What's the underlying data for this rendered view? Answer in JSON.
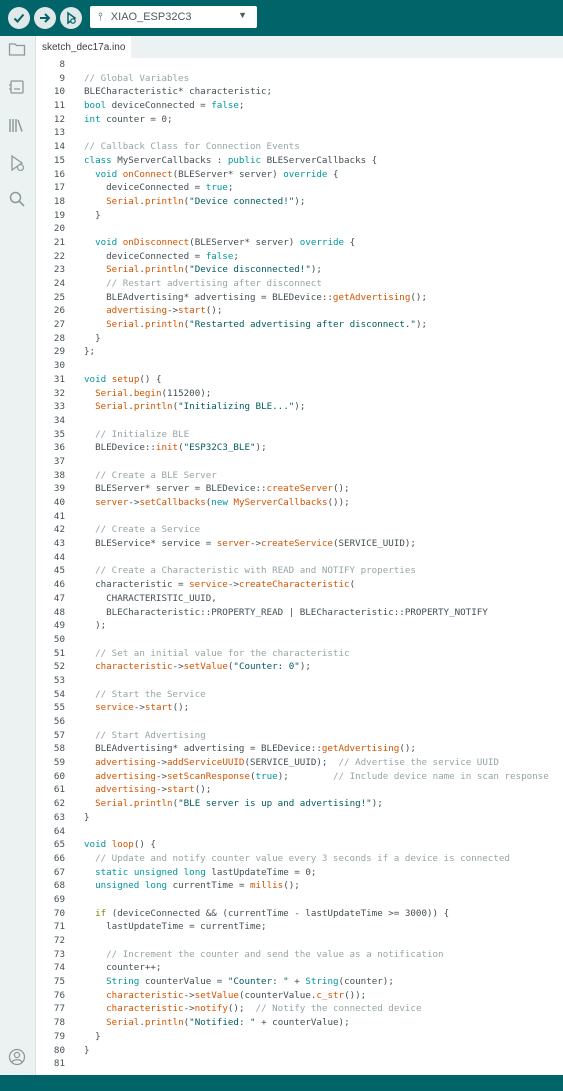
{
  "toolbar": {
    "verify_icon": "check-icon",
    "upload_icon": "arrow-right-icon",
    "debug_icon": "debug-icon",
    "board": "XIAO_ESP32C3",
    "board_icon": "usb-icon"
  },
  "sidebar": {
    "items": [
      {
        "name": "sketchbook",
        "icon": "folder-icon"
      },
      {
        "name": "boards-manager",
        "icon": "board-icon"
      },
      {
        "name": "library-manager",
        "icon": "library-icon"
      },
      {
        "name": "debug",
        "icon": "debug-play-icon"
      },
      {
        "name": "search",
        "icon": "search-icon"
      }
    ],
    "profile_icon": "user-icon"
  },
  "tabs": [
    {
      "label": "sketch_dec17a.ino",
      "active": true
    }
  ],
  "colors": {
    "toolbar_bg": "#006468",
    "type": "#00979c",
    "keyword": "#728e00",
    "function": "#d35400",
    "comment": "#95a5a6",
    "string": "#005c5f"
  },
  "code_lines": [
    {
      "n": "8",
      "segs": []
    },
    {
      "n": "9",
      "segs": [
        [
          "cm",
          "// Global Variables"
        ]
      ]
    },
    {
      "n": "10",
      "segs": [
        [
          "",
          "BLECharacteristic* characteristic;"
        ]
      ]
    },
    {
      "n": "11",
      "segs": [
        [
          "kw-type",
          "bool"
        ],
        [
          "",
          " deviceConnected = "
        ],
        [
          "kw-type",
          "false"
        ],
        [
          "",
          ";"
        ]
      ]
    },
    {
      "n": "12",
      "segs": [
        [
          "kw-type",
          "int"
        ],
        [
          "",
          " counter = 0;"
        ]
      ]
    },
    {
      "n": "13",
      "segs": []
    },
    {
      "n": "14",
      "segs": [
        [
          "cm",
          "// Callback Class for Connection Events"
        ]
      ]
    },
    {
      "n": "15",
      "segs": [
        [
          "kw-type",
          "class"
        ],
        [
          "",
          " MyServerCallbacks : "
        ],
        [
          "kw-type",
          "public"
        ],
        [
          "",
          " BLEServerCallbacks {"
        ]
      ]
    },
    {
      "n": "16",
      "segs": [
        [
          "",
          "  "
        ],
        [
          "kw-type",
          "void"
        ],
        [
          "",
          " "
        ],
        [
          "fn",
          "onConnect"
        ],
        [
          "",
          "(BLEServer* server) "
        ],
        [
          "kw-type",
          "override"
        ],
        [
          "",
          " {"
        ]
      ]
    },
    {
      "n": "17",
      "segs": [
        [
          "",
          "    deviceConnected = "
        ],
        [
          "kw-type",
          "true"
        ],
        [
          "",
          ";"
        ]
      ]
    },
    {
      "n": "18",
      "segs": [
        [
          "",
          "    "
        ],
        [
          "fn",
          "Serial"
        ],
        [
          "",
          "."
        ],
        [
          "fn",
          "println"
        ],
        [
          "",
          "("
        ],
        [
          "str",
          "\"Device connected!\""
        ],
        [
          "",
          ");"
        ]
      ]
    },
    {
      "n": "19",
      "segs": [
        [
          "",
          "  }"
        ]
      ]
    },
    {
      "n": "20",
      "segs": []
    },
    {
      "n": "21",
      "segs": [
        [
          "",
          "  "
        ],
        [
          "kw-type",
          "void"
        ],
        [
          "",
          " "
        ],
        [
          "fn",
          "onDisconnect"
        ],
        [
          "",
          "(BLEServer* server) "
        ],
        [
          "kw-type",
          "override"
        ],
        [
          "",
          " {"
        ]
      ]
    },
    {
      "n": "22",
      "segs": [
        [
          "",
          "    deviceConnected = "
        ],
        [
          "kw-type",
          "false"
        ],
        [
          "",
          ";"
        ]
      ]
    },
    {
      "n": "23",
      "segs": [
        [
          "",
          "    "
        ],
        [
          "fn",
          "Serial"
        ],
        [
          "",
          "."
        ],
        [
          "fn",
          "println"
        ],
        [
          "",
          "("
        ],
        [
          "str",
          "\"Device disconnected!\""
        ],
        [
          "",
          ");"
        ]
      ]
    },
    {
      "n": "24",
      "segs": [
        [
          "",
          "    "
        ],
        [
          "cm",
          "// Restart advertising after disconnect"
        ]
      ]
    },
    {
      "n": "25",
      "segs": [
        [
          "",
          "    BLEAdvertising* advertising = BLEDevice::"
        ],
        [
          "fn",
          "getAdvertising"
        ],
        [
          "",
          "();"
        ]
      ]
    },
    {
      "n": "26",
      "segs": [
        [
          "",
          "    "
        ],
        [
          "fn",
          "advertising"
        ],
        [
          "",
          "->"
        ],
        [
          "fn",
          "start"
        ],
        [
          "",
          "();"
        ]
      ]
    },
    {
      "n": "27",
      "segs": [
        [
          "",
          "    "
        ],
        [
          "fn",
          "Serial"
        ],
        [
          "",
          "."
        ],
        [
          "fn",
          "println"
        ],
        [
          "",
          "("
        ],
        [
          "str",
          "\"Restarted advertising after disconnect.\""
        ],
        [
          "",
          ");"
        ]
      ]
    },
    {
      "n": "28",
      "segs": [
        [
          "",
          "  }"
        ]
      ]
    },
    {
      "n": "29",
      "segs": [
        [
          "",
          "};"
        ]
      ]
    },
    {
      "n": "30",
      "segs": []
    },
    {
      "n": "31",
      "segs": [
        [
          "kw-type",
          "void"
        ],
        [
          "",
          " "
        ],
        [
          "fn",
          "setup"
        ],
        [
          "",
          "() {"
        ]
      ]
    },
    {
      "n": "32",
      "segs": [
        [
          "",
          "  "
        ],
        [
          "fn",
          "Serial"
        ],
        [
          "",
          "."
        ],
        [
          "fn",
          "begin"
        ],
        [
          "",
          "(115200);"
        ]
      ]
    },
    {
      "n": "33",
      "segs": [
        [
          "",
          "  "
        ],
        [
          "fn",
          "Serial"
        ],
        [
          "",
          "."
        ],
        [
          "fn",
          "println"
        ],
        [
          "",
          "("
        ],
        [
          "str",
          "\"Initializing BLE...\""
        ],
        [
          "",
          ");"
        ]
      ]
    },
    {
      "n": "34",
      "segs": []
    },
    {
      "n": "35",
      "segs": [
        [
          "",
          "  "
        ],
        [
          "cm",
          "// Initialize BLE"
        ]
      ]
    },
    {
      "n": "36",
      "segs": [
        [
          "",
          "  BLEDevice::"
        ],
        [
          "fn",
          "init"
        ],
        [
          "",
          "("
        ],
        [
          "str",
          "\"ESP32C3_BLE\""
        ],
        [
          "",
          ");"
        ]
      ]
    },
    {
      "n": "37",
      "segs": []
    },
    {
      "n": "38",
      "segs": [
        [
          "",
          "  "
        ],
        [
          "cm",
          "// Create a BLE Server"
        ]
      ]
    },
    {
      "n": "39",
      "segs": [
        [
          "",
          "  BLEServer* server = BLEDevice::"
        ],
        [
          "fn",
          "createServer"
        ],
        [
          "",
          "();"
        ]
      ]
    },
    {
      "n": "40",
      "segs": [
        [
          "",
          "  "
        ],
        [
          "fn",
          "server"
        ],
        [
          "",
          "->"
        ],
        [
          "fn",
          "setCallbacks"
        ],
        [
          "",
          "("
        ],
        [
          "kw-type",
          "new"
        ],
        [
          "",
          " "
        ],
        [
          "fn",
          "MyServerCallbacks"
        ],
        [
          "",
          "());"
        ]
      ]
    },
    {
      "n": "41",
      "segs": []
    },
    {
      "n": "42",
      "segs": [
        [
          "",
          "  "
        ],
        [
          "cm",
          "// Create a Service"
        ]
      ]
    },
    {
      "n": "43",
      "segs": [
        [
          "",
          "  BLEService* service = "
        ],
        [
          "fn",
          "server"
        ],
        [
          "",
          "->"
        ],
        [
          "fn",
          "createService"
        ],
        [
          "",
          "(SERVICE_UUID);"
        ]
      ]
    },
    {
      "n": "44",
      "segs": []
    },
    {
      "n": "45",
      "segs": [
        [
          "",
          "  "
        ],
        [
          "cm",
          "// Create a Characteristic with READ and NOTIFY properties"
        ]
      ]
    },
    {
      "n": "46",
      "segs": [
        [
          "",
          "  characteristic = "
        ],
        [
          "fn",
          "service"
        ],
        [
          "",
          "->"
        ],
        [
          "fn",
          "createCharacteristic"
        ],
        [
          "",
          "("
        ]
      ]
    },
    {
      "n": "47",
      "segs": [
        [
          "",
          "    CHARACTERISTIC_UUID,"
        ]
      ]
    },
    {
      "n": "48",
      "segs": [
        [
          "",
          "    BLECharacteristic::PROPERTY_READ | BLECharacteristic::PROPERTY_NOTIFY"
        ]
      ]
    },
    {
      "n": "49",
      "segs": [
        [
          "",
          "  );"
        ]
      ]
    },
    {
      "n": "50",
      "segs": []
    },
    {
      "n": "51",
      "segs": [
        [
          "",
          "  "
        ],
        [
          "cm",
          "// Set an initial value for the characteristic"
        ]
      ]
    },
    {
      "n": "52",
      "segs": [
        [
          "",
          "  "
        ],
        [
          "fn",
          "characteristic"
        ],
        [
          "",
          "->"
        ],
        [
          "fn",
          "setValue"
        ],
        [
          "",
          "("
        ],
        [
          "str",
          "\"Counter: 0\""
        ],
        [
          "",
          ");"
        ]
      ]
    },
    {
      "n": "53",
      "segs": []
    },
    {
      "n": "54",
      "segs": [
        [
          "",
          "  "
        ],
        [
          "cm",
          "// Start the Service"
        ]
      ]
    },
    {
      "n": "55",
      "segs": [
        [
          "",
          "  "
        ],
        [
          "fn",
          "service"
        ],
        [
          "",
          "->"
        ],
        [
          "fn",
          "start"
        ],
        [
          "",
          "();"
        ]
      ]
    },
    {
      "n": "56",
      "segs": []
    },
    {
      "n": "57",
      "segs": [
        [
          "",
          "  "
        ],
        [
          "cm",
          "// Start Advertising"
        ]
      ]
    },
    {
      "n": "58",
      "segs": [
        [
          "",
          "  BLEAdvertising* advertising = BLEDevice::"
        ],
        [
          "fn",
          "getAdvertising"
        ],
        [
          "",
          "();"
        ]
      ]
    },
    {
      "n": "59",
      "segs": [
        [
          "",
          "  "
        ],
        [
          "fn",
          "advertising"
        ],
        [
          "",
          "->"
        ],
        [
          "fn",
          "addServiceUUID"
        ],
        [
          "",
          "(SERVICE_UUID);  "
        ],
        [
          "cm",
          "// Advertise the service UUID"
        ]
      ]
    },
    {
      "n": "60",
      "segs": [
        [
          "",
          "  "
        ],
        [
          "fn",
          "advertising"
        ],
        [
          "",
          "->"
        ],
        [
          "fn",
          "setScanResponse"
        ],
        [
          "",
          "("
        ],
        [
          "kw-type",
          "true"
        ],
        [
          "",
          ");        "
        ],
        [
          "cm",
          "// Include device name in scan response"
        ]
      ]
    },
    {
      "n": "61",
      "segs": [
        [
          "",
          "  "
        ],
        [
          "fn",
          "advertising"
        ],
        [
          "",
          "->"
        ],
        [
          "fn",
          "start"
        ],
        [
          "",
          "();"
        ]
      ]
    },
    {
      "n": "62",
      "segs": [
        [
          "",
          "  "
        ],
        [
          "fn",
          "Serial"
        ],
        [
          "",
          "."
        ],
        [
          "fn",
          "println"
        ],
        [
          "",
          "("
        ],
        [
          "str",
          "\"BLE server is up and advertising!\""
        ],
        [
          "",
          ");"
        ]
      ]
    },
    {
      "n": "63",
      "segs": [
        [
          "",
          "}"
        ]
      ]
    },
    {
      "n": "64",
      "segs": []
    },
    {
      "n": "65",
      "segs": [
        [
          "kw-type",
          "void"
        ],
        [
          "",
          " "
        ],
        [
          "fn",
          "loop"
        ],
        [
          "",
          "() {"
        ]
      ]
    },
    {
      "n": "66",
      "segs": [
        [
          "",
          "  "
        ],
        [
          "cm",
          "// Update and notify counter value every 3 seconds if a device is connected"
        ]
      ]
    },
    {
      "n": "67",
      "segs": [
        [
          "",
          "  "
        ],
        [
          "kw-type",
          "static"
        ],
        [
          "",
          " "
        ],
        [
          "kw-type",
          "unsigned"
        ],
        [
          "",
          " "
        ],
        [
          "kw-type",
          "long"
        ],
        [
          "",
          " lastUpdateTime = 0;"
        ]
      ]
    },
    {
      "n": "68",
      "segs": [
        [
          "",
          "  "
        ],
        [
          "kw-type",
          "unsigned"
        ],
        [
          "",
          " "
        ],
        [
          "kw-type",
          "long"
        ],
        [
          "",
          " currentTime = "
        ],
        [
          "fn",
          "millis"
        ],
        [
          "",
          "();"
        ]
      ]
    },
    {
      "n": "69",
      "segs": []
    },
    {
      "n": "70",
      "segs": [
        [
          "",
          "  "
        ],
        [
          "kw",
          "if"
        ],
        [
          "",
          " (deviceConnected && (currentTime - lastUpdateTime >= 3000)) {"
        ]
      ]
    },
    {
      "n": "71",
      "segs": [
        [
          "",
          "    lastUpdateTime = currentTime;"
        ]
      ]
    },
    {
      "n": "72",
      "segs": []
    },
    {
      "n": "73",
      "segs": [
        [
          "",
          "    "
        ],
        [
          "cm",
          "// Increment the counter and send the value as a notification"
        ]
      ]
    },
    {
      "n": "74",
      "segs": [
        [
          "",
          "    counter++;"
        ]
      ]
    },
    {
      "n": "75",
      "segs": [
        [
          "",
          "    "
        ],
        [
          "kw-type",
          "String"
        ],
        [
          "",
          " counterValue = "
        ],
        [
          "str",
          "\"Counter: \""
        ],
        [
          "",
          " + "
        ],
        [
          "kw-type",
          "String"
        ],
        [
          "",
          "(counter);"
        ]
      ]
    },
    {
      "n": "76",
      "segs": [
        [
          "",
          "    "
        ],
        [
          "fn",
          "characteristic"
        ],
        [
          "",
          "->"
        ],
        [
          "fn",
          "setValue"
        ],
        [
          "",
          "(counterValue."
        ],
        [
          "fn",
          "c_str"
        ],
        [
          "",
          "());"
        ]
      ]
    },
    {
      "n": "77",
      "segs": [
        [
          "",
          "    "
        ],
        [
          "fn",
          "characteristic"
        ],
        [
          "",
          "->"
        ],
        [
          "fn",
          "notify"
        ],
        [
          "",
          "();  "
        ],
        [
          "cm",
          "// Notify the connected device"
        ]
      ]
    },
    {
      "n": "78",
      "segs": [
        [
          "",
          "    "
        ],
        [
          "fn",
          "Serial"
        ],
        [
          "",
          "."
        ],
        [
          "fn",
          "println"
        ],
        [
          "",
          "("
        ],
        [
          "str",
          "\"Notified: \""
        ],
        [
          "",
          " + counterValue);"
        ]
      ]
    },
    {
      "n": "79",
      "segs": [
        [
          "",
          "  }"
        ]
      ]
    },
    {
      "n": "80",
      "segs": [
        [
          "",
          "}"
        ]
      ]
    },
    {
      "n": "81",
      "segs": []
    }
  ]
}
